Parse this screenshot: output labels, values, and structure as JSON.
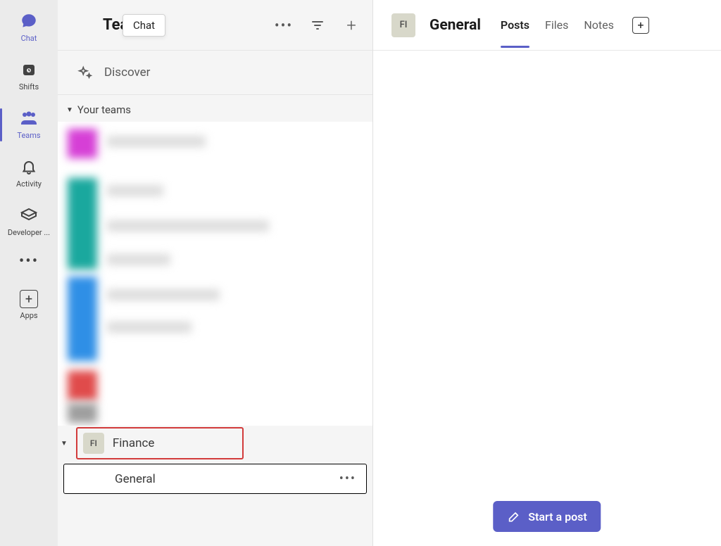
{
  "rail": {
    "chat": "Chat",
    "shifts": "Shifts",
    "teams": "Teams",
    "activity": "Activity",
    "developer": "Developer ...",
    "apps": "Apps"
  },
  "tooltip": {
    "chat": "Chat"
  },
  "panel": {
    "title": "Teams",
    "discover": "Discover",
    "section_your_teams": "Your teams",
    "finance_team": {
      "avatar": "FI",
      "name": "Finance"
    },
    "channel_general": "General"
  },
  "main": {
    "avatar": "FI",
    "title": "General",
    "tabs": {
      "posts": "Posts",
      "files": "Files",
      "notes": "Notes"
    },
    "start_post": "Start a post"
  }
}
